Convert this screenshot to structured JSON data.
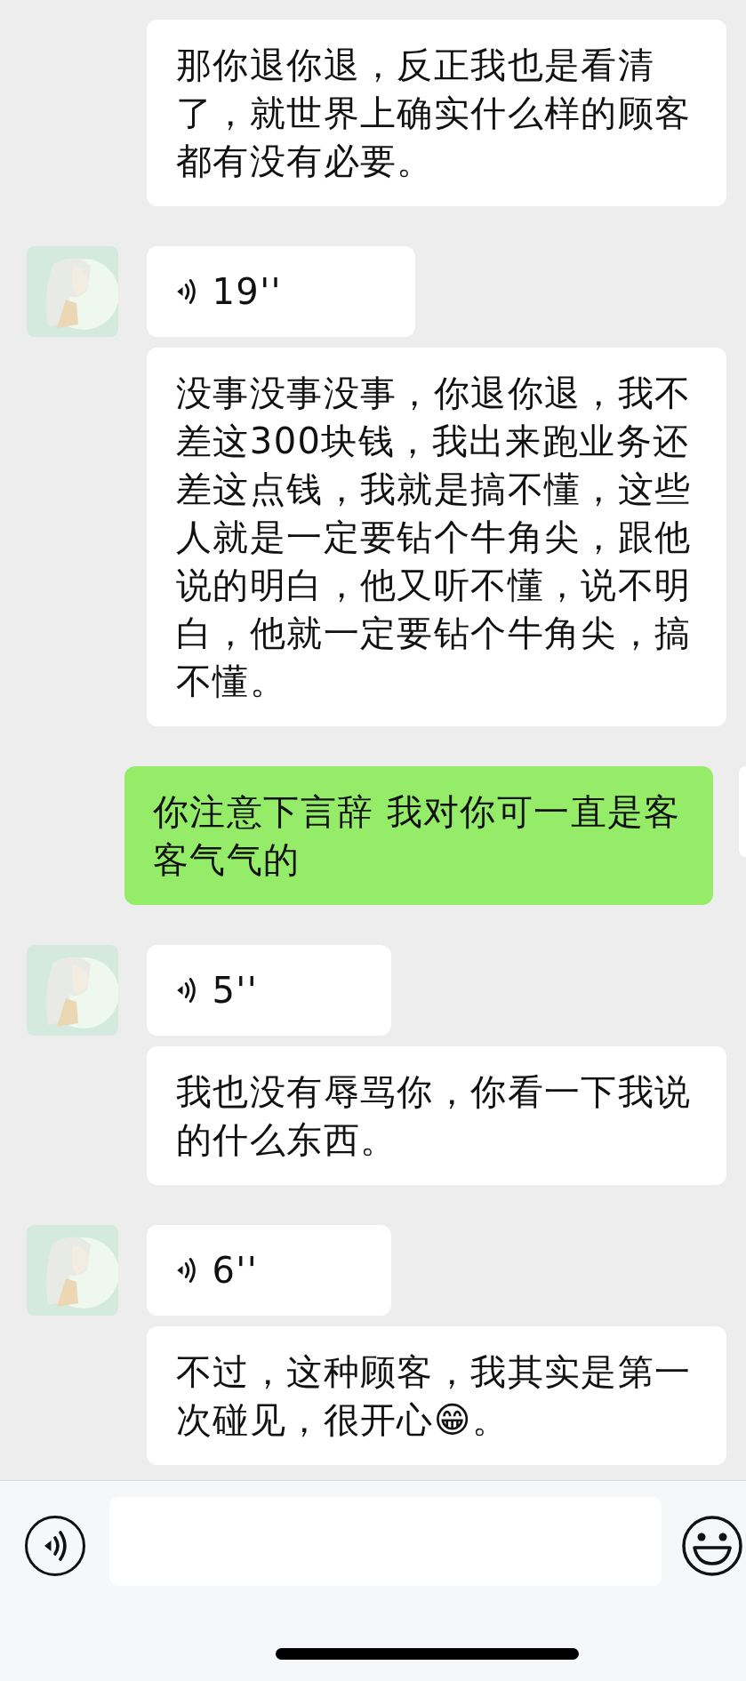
{
  "messages": [
    {
      "kind": "text",
      "outgoing": false,
      "avatar": false,
      "text": "那你退你退，反正我也是看清了，就世界上确实什么样的顾客都有没有必要。"
    },
    {
      "kind": "voice",
      "outgoing": false,
      "avatar": true,
      "duration": "19''"
    },
    {
      "kind": "text",
      "outgoing": false,
      "avatar": false,
      "text": "没事没事没事，你退你退，我不差这300块钱，我出来跑业务还差这点钱，我就是搞不懂，这些人就是一定要钻个牛角尖，跟他说的明白，他又听不懂，说不明白，他就一定要钻个牛角尖，搞不懂。"
    },
    {
      "kind": "text",
      "outgoing": true,
      "text": "你注意下言辞 我对你可一直是客客气气的"
    },
    {
      "kind": "voice",
      "outgoing": false,
      "avatar": true,
      "duration": "5''"
    },
    {
      "kind": "text",
      "outgoing": false,
      "avatar": false,
      "text": "我也没有辱骂你，你看一下我说的什么东西。"
    },
    {
      "kind": "voice",
      "outgoing": false,
      "avatar": true,
      "duration": "6''"
    },
    {
      "kind": "text",
      "outgoing": false,
      "avatar": false,
      "text": "不过，这种顾客，我其实是第一次碰见，很开心😁。"
    }
  ]
}
